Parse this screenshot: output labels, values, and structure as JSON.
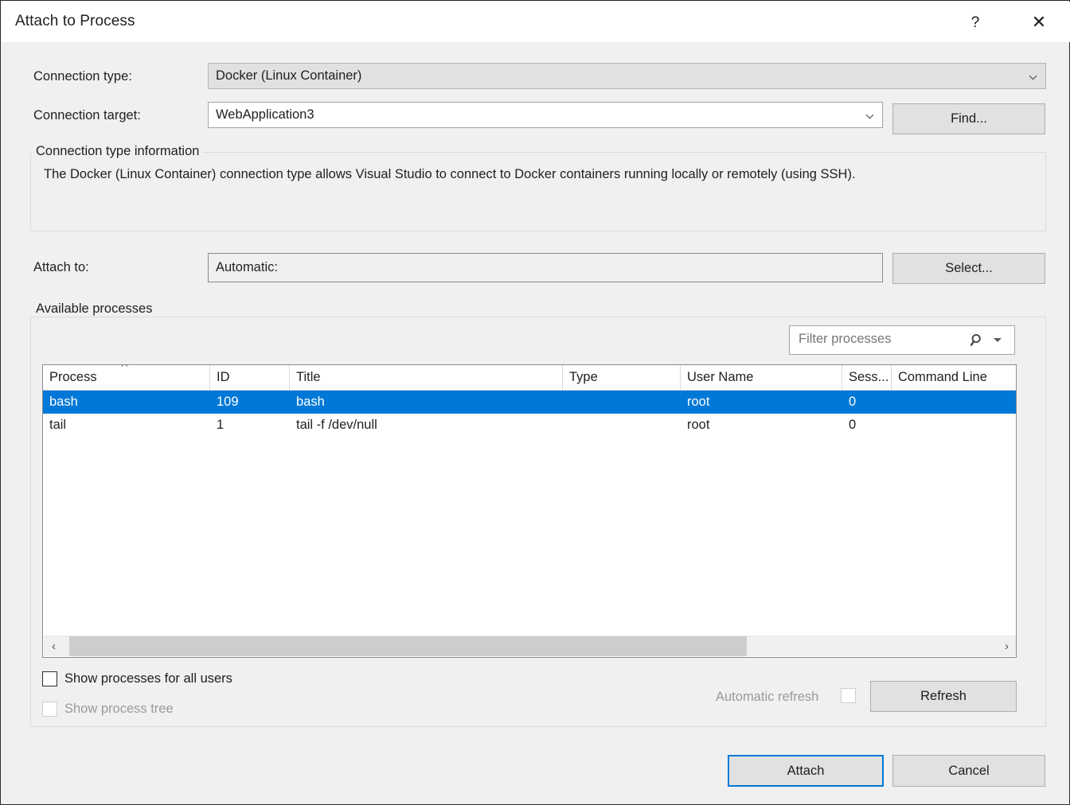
{
  "window": {
    "title": "Attach to Process",
    "help_icon": "?",
    "close_icon": "✕"
  },
  "connection": {
    "type_label": "Connection type:",
    "type_value": "Docker (Linux Container)",
    "target_label": "Connection target:",
    "target_value": "WebApplication3",
    "find_button": "Find...",
    "info_group_title": "Connection type information",
    "info_text": "The Docker (Linux Container) connection type allows Visual Studio to connect to Docker containers running locally or remotely (using SSH)."
  },
  "attach_to": {
    "label": "Attach to:",
    "value": "Automatic:",
    "select_button": "Select..."
  },
  "processes": {
    "group_title": "Available processes",
    "filter_placeholder": "Filter processes",
    "filter_value": "",
    "sort_indicator": "˄",
    "columns": [
      {
        "key": "process",
        "label": "Process"
      },
      {
        "key": "id",
        "label": "ID"
      },
      {
        "key": "title",
        "label": "Title"
      },
      {
        "key": "type",
        "label": "Type"
      },
      {
        "key": "user_name",
        "label": "User Name"
      },
      {
        "key": "session",
        "label": "Sess..."
      },
      {
        "key": "command_line",
        "label": "Command Line"
      }
    ],
    "rows": [
      {
        "process": "bash",
        "id": "109",
        "title": "bash",
        "type": "",
        "user_name": "root",
        "session": "0",
        "command_line": "",
        "selected": true
      },
      {
        "process": "tail",
        "id": "1",
        "title": "tail -f /dev/null",
        "type": "",
        "user_name": "root",
        "session": "0",
        "command_line": "",
        "selected": false
      }
    ],
    "scroll_left_icon": "‹",
    "scroll_right_icon": "›"
  },
  "options": {
    "show_all_users_label": "Show processes for all users",
    "show_all_users_checked": false,
    "show_process_tree_label": "Show process tree",
    "show_process_tree_checked": false,
    "show_process_tree_enabled": false,
    "automatic_refresh_label": "Automatic refresh",
    "automatic_refresh_checked": false,
    "automatic_refresh_enabled": false,
    "refresh_button": "Refresh"
  },
  "footer": {
    "attach_button": "Attach",
    "cancel_button": "Cancel"
  },
  "colors": {
    "accent": "#0078d7",
    "selection": "#0078d7",
    "dialog_bg": "#f0f0f0",
    "field_bg": "#ffffff",
    "disabled_text": "#9a9a9a"
  }
}
